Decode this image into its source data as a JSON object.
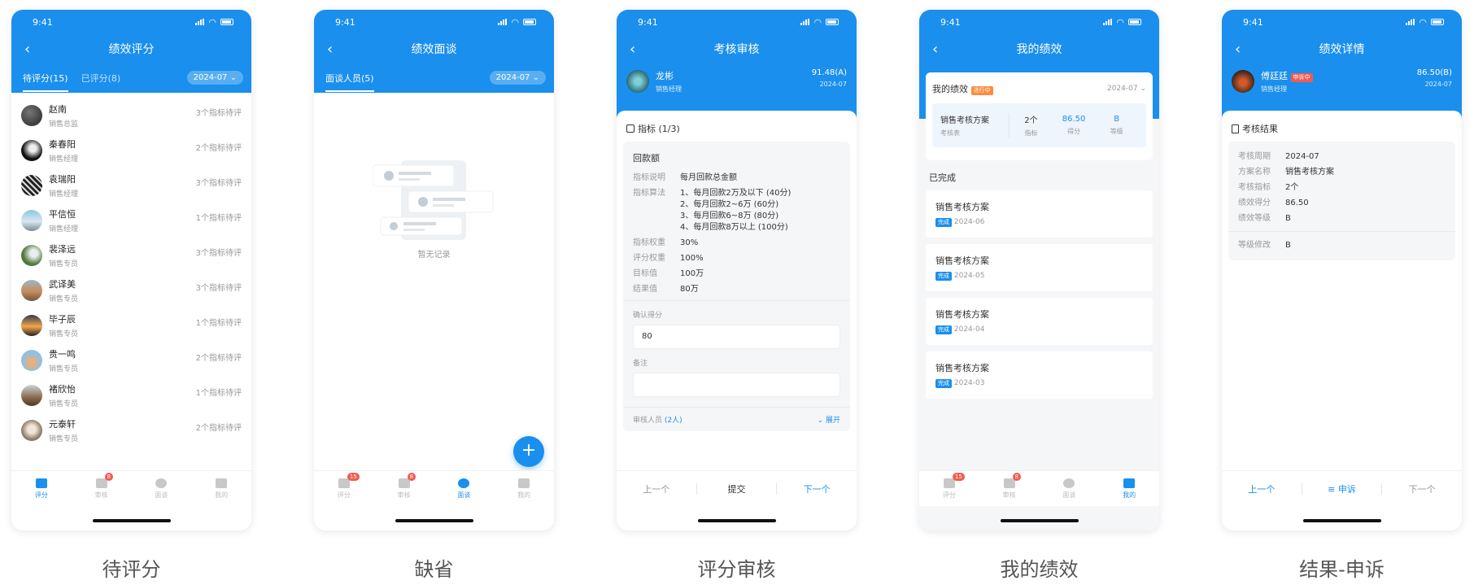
{
  "status_time": "9:41",
  "colors": {
    "primary": "#1a8fee",
    "danger": "#f35a4e",
    "orange": "#ff8a3d"
  },
  "captions": [
    "待评分",
    "缺省",
    "评分审核",
    "我的绩效",
    "结果-申诉"
  ],
  "bottom_tabs": [
    "评分",
    "审核",
    "面谈",
    "我的"
  ],
  "screen1": {
    "title": "绩效评分",
    "tabs": [
      "待评分(15)",
      "已评分(8)"
    ],
    "date": "2024-07",
    "badge_audit": "8",
    "items": [
      {
        "name": "赵南",
        "role": "销售总监",
        "status": "3个指标待评"
      },
      {
        "name": "秦春阳",
        "role": "销售经理",
        "status": "2个指标待评"
      },
      {
        "name": "袁瑞阳",
        "role": "销售经理",
        "status": "3个指标待评"
      },
      {
        "name": "平信恒",
        "role": "销售经理",
        "status": "1个指标待评"
      },
      {
        "name": "裴泽远",
        "role": "销售专员",
        "status": "3个指标待评"
      },
      {
        "name": "武译美",
        "role": "销售专员",
        "status": "3个指标待评"
      },
      {
        "name": "毕子辰",
        "role": "销售专员",
        "status": "1个指标待评"
      },
      {
        "name": "贵一鸣",
        "role": "销售专员",
        "status": "2个指标待评"
      },
      {
        "name": "褚欣怡",
        "role": "销售专员",
        "status": "1个指标待评"
      },
      {
        "name": "元泰轩",
        "role": "销售专员",
        "status": "2个指标待评"
      }
    ]
  },
  "screen2": {
    "title": "绩效面谈",
    "tab": "面谈人员(5)",
    "date": "2024-07",
    "empty_text": "暂无记录",
    "fab": "+",
    "badge_score": "15",
    "badge_audit": "8"
  },
  "screen3": {
    "title": "考核审核",
    "user_name": "龙彬",
    "user_role": "销售经理",
    "score": "91.48(A)",
    "date": "2024-07",
    "section_title": "指标 (1/3)",
    "indicator_name": "回款额",
    "fields": [
      {
        "k": "指标说明",
        "v": "每月回款总金额"
      },
      {
        "k": "指标算法",
        "v": "1、每月回款2万及以下 (40分)\n2、每月回款2~6万 (60分)\n3、每月回款6~8万 (80分)\n4、每月回款8万以上 (100分)"
      },
      {
        "k": "指标权重",
        "v": "30%"
      },
      {
        "k": "评分权重",
        "v": "100%"
      },
      {
        "k": "目标值",
        "v": "100万"
      },
      {
        "k": "结果值",
        "v": "80万"
      }
    ],
    "confirm_label": "确认得分",
    "confirm_value": "80",
    "remark_label": "备注",
    "reviewer_label": "审核人员",
    "reviewer_count": "(2人)",
    "expand": "展开",
    "prev": "上一个",
    "submit": "提交",
    "next": "下一个"
  },
  "screen4": {
    "title": "我的绩效",
    "card_title": "我的绩效",
    "card_tag": "进行中",
    "date": "2024-07",
    "plan_name": "销售考核方案",
    "plan_sub": "考核表",
    "stats": [
      {
        "v": "2个",
        "k": "指标"
      },
      {
        "v": "86.50",
        "k": "得分"
      },
      {
        "v": "B",
        "k": "等级"
      }
    ],
    "done_title": "已完成",
    "done_tag": "完成",
    "history": [
      {
        "name": "销售考核方案",
        "date": "2024-06"
      },
      {
        "name": "销售考核方案",
        "date": "2024-05"
      },
      {
        "name": "销售考核方案",
        "date": "2024-04"
      },
      {
        "name": "销售考核方案",
        "date": "2024-03"
      }
    ],
    "badge_score": "15",
    "badge_audit": "8"
  },
  "screen5": {
    "title": "绩效详情",
    "user_name": "傅廷廷",
    "user_tag": "申诉中",
    "user_role": "销售经理",
    "score": "86.50(B)",
    "date": "2024-07",
    "section_title": "考核结果",
    "fields": [
      {
        "k": "考核周期",
        "v": "2024-07"
      },
      {
        "k": "方案名称",
        "v": "销售考核方案"
      },
      {
        "k": "考核指标",
        "v": "2个"
      },
      {
        "k": "绩效得分",
        "v": "86.50"
      },
      {
        "k": "绩效等级",
        "v": "B"
      }
    ],
    "final_k": "等级修改",
    "final_v": "B",
    "prev": "上一个",
    "appeal": "申诉",
    "next": "下一个"
  }
}
